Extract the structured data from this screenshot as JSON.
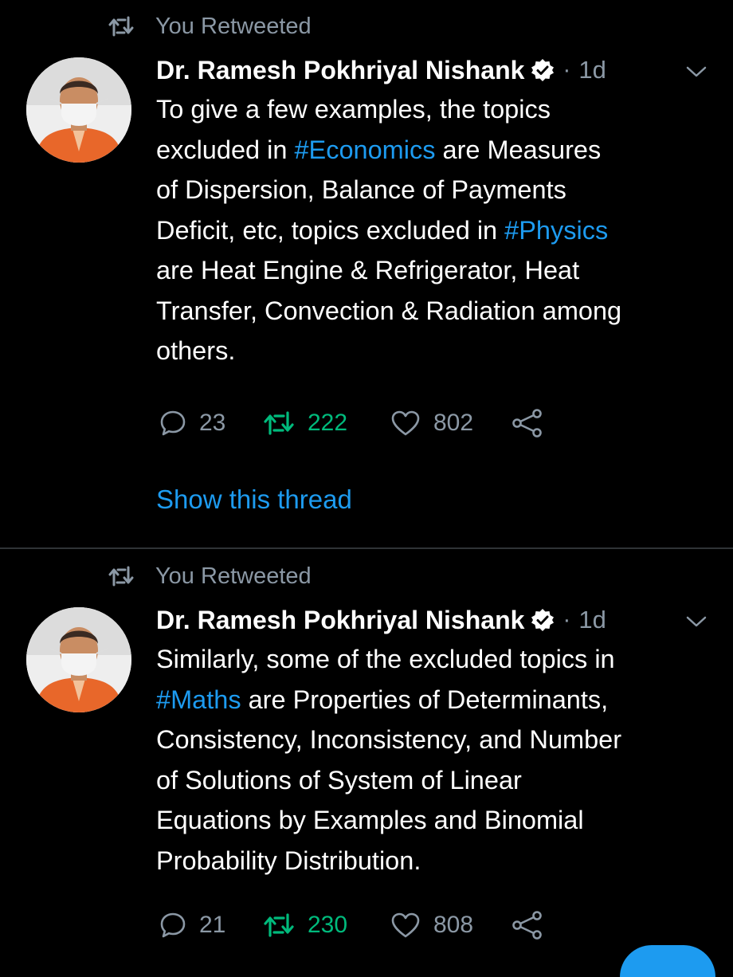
{
  "tweets": [
    {
      "retweet_label": "You Retweeted",
      "author_name": "Dr. Ramesh Pokhriyal Nishank",
      "dot": "·",
      "time": "1d",
      "lines": [
        [
          {
            "t": "To give a few examples, the topics"
          }
        ],
        [
          {
            "t": "excluded in "
          },
          {
            "t": "#Economics",
            "tag": true
          },
          {
            "t": " are Measures"
          }
        ],
        [
          {
            "t": "of Dispersion, Balance of Payments"
          }
        ],
        [
          {
            "t": "Deficit, etc, topics excluded in "
          },
          {
            "t": "#Physics",
            "tag": true
          }
        ],
        [
          {
            "t": "are Heat Engine & Refrigerator, Heat"
          }
        ],
        [
          {
            "t": "Transfer, Convection & Radiation among"
          }
        ],
        [
          {
            "t": "others."
          }
        ]
      ],
      "reply_count": "23",
      "retweet_count": "222",
      "like_count": "802",
      "retweeted": true,
      "show_thread": "Show this thread"
    },
    {
      "retweet_label": "You Retweeted",
      "author_name": "Dr. Ramesh Pokhriyal Nishank",
      "dot": "·",
      "time": "1d",
      "lines": [
        [
          {
            "t": "Similarly, some of the excluded topics in"
          }
        ],
        [
          {
            "t": "#Maths",
            "tag": true
          },
          {
            "t": " are Properties of Determinants,"
          }
        ],
        [
          {
            "t": "Consistency, Inconsistency, and Number"
          }
        ],
        [
          {
            "t": "of Solutions of System of Linear"
          }
        ],
        [
          {
            "t": "Equations by Examples and Binomial"
          }
        ],
        [
          {
            "t": "Probability Distribution."
          }
        ]
      ],
      "reply_count": "21",
      "retweet_count": "230",
      "like_count": "808",
      "retweeted": true
    }
  ],
  "colors": {
    "background": "#000000",
    "text": "#ffffff",
    "muted": "#8b98a5",
    "hashtag": "#1d9bf0",
    "retweet_active": "#00ba7c",
    "verified_badge": "#ffffff"
  },
  "icons": {
    "retweet": "retweet-icon",
    "verified": "verified-badge-icon",
    "caret": "chevron-down-icon",
    "reply": "reply-icon",
    "like": "heart-icon",
    "share": "share-icon"
  }
}
